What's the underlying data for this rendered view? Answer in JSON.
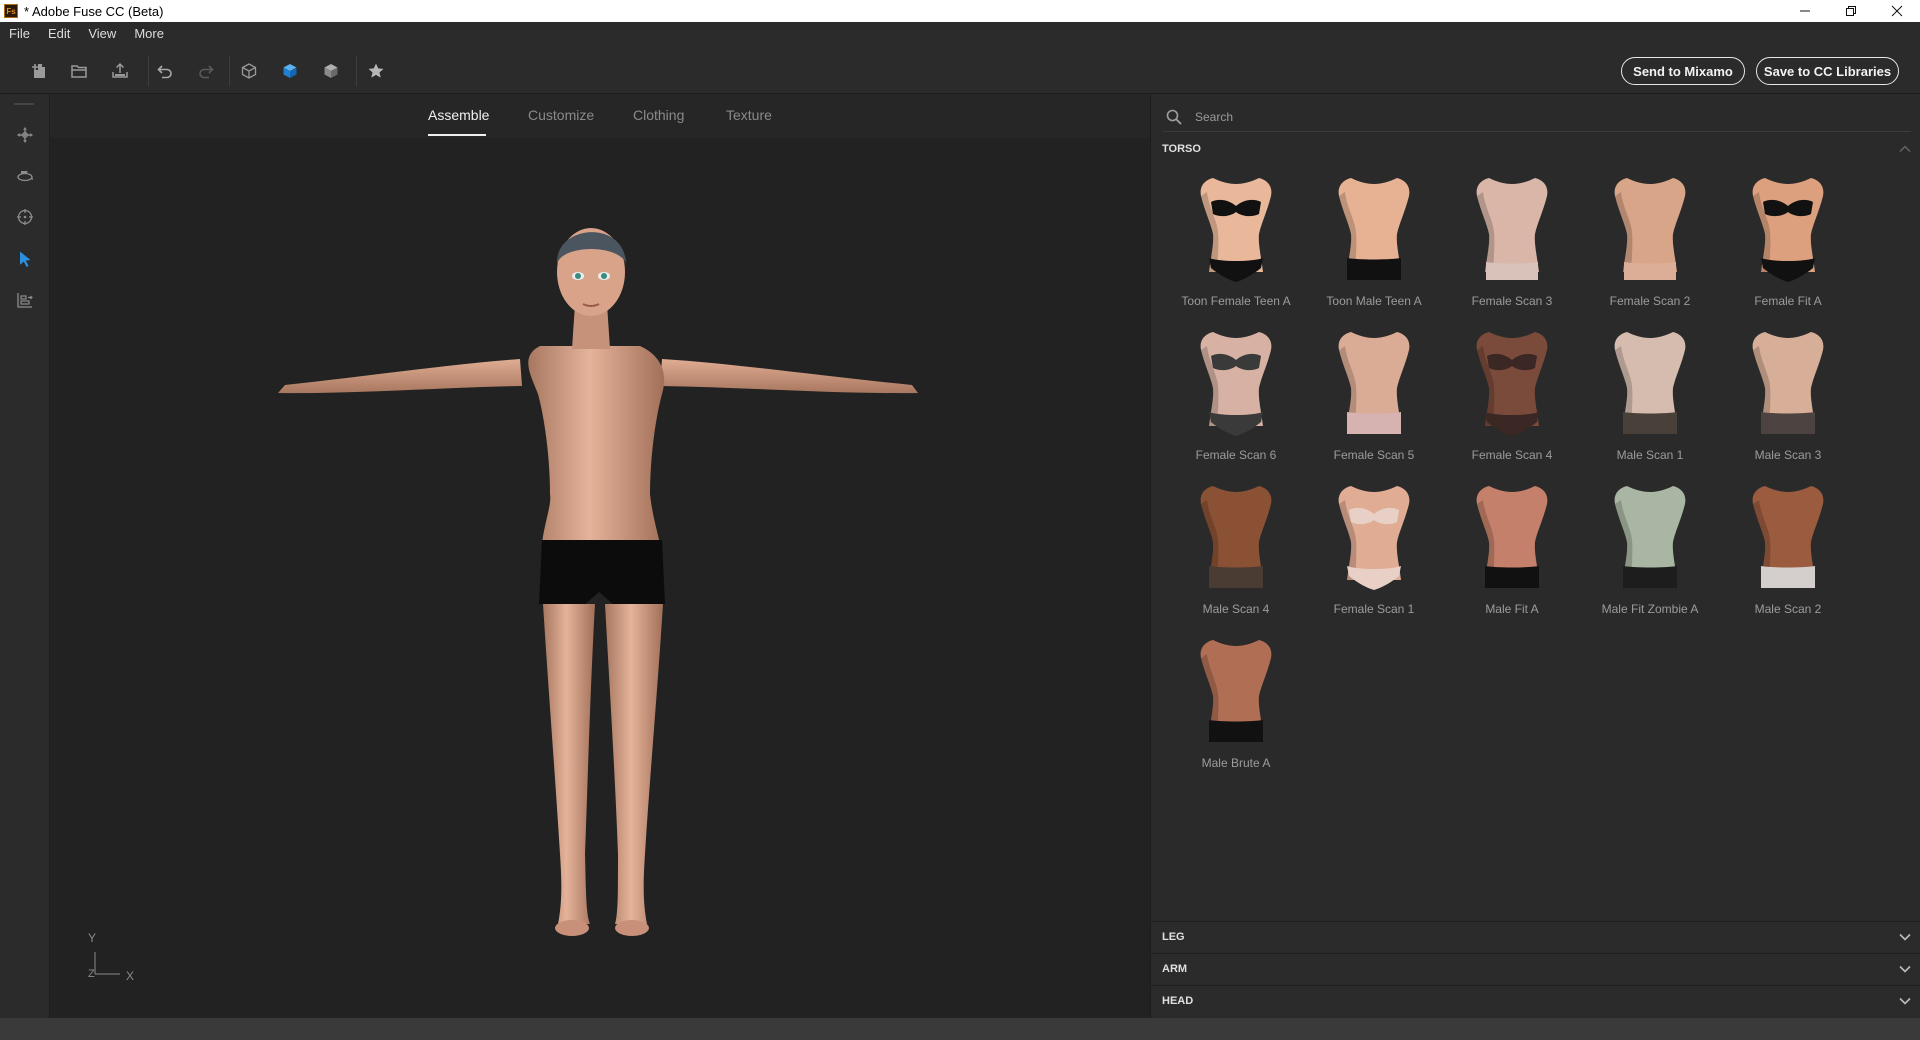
{
  "window": {
    "title": "* Adobe Fuse CC (Beta)",
    "logo_text": "Fs"
  },
  "menu": [
    "File",
    "Edit",
    "View",
    "More"
  ],
  "toolbar": {
    "send_label": "Send to Mixamo",
    "save_label": "Save to CC Libraries",
    "tools": [
      "new-doc-icon",
      "open-folder-icon",
      "export-icon",
      "undo-icon",
      "redo-icon",
      "cube-wire-icon",
      "cube-solid-icon",
      "cube-shaded-icon",
      "star-icon"
    ]
  },
  "left_rail": [
    "move-icon",
    "rotate-view-icon",
    "target-icon",
    "pointer-icon",
    "pose-icon"
  ],
  "viewport": {
    "tabs": [
      "Assemble",
      "Customize",
      "Clothing",
      "Texture"
    ],
    "active_tab": "Assemble",
    "axes": {
      "y": "Y",
      "x": "X",
      "z": "Z"
    }
  },
  "panel": {
    "search_placeholder": "Search",
    "section_open": "TORSO",
    "torso_items": [
      {
        "label": "Toon Female Teen A",
        "tone": "#e9b89a",
        "underwear": "bikini",
        "garment": "#111111"
      },
      {
        "label": "Toon Male Teen A",
        "tone": "#e6b293",
        "underwear": "brief",
        "garment": "#111111"
      },
      {
        "label": "Female Scan 3",
        "tone": "#d9b6a8",
        "underwear": "none",
        "garment": "#d8c2ba"
      },
      {
        "label": "Female Scan 2",
        "tone": "#d9a588",
        "underwear": "none",
        "garment": "#dcae98"
      },
      {
        "label": "Female Fit A",
        "tone": "#dca07f",
        "underwear": "bikini",
        "garment": "#111111"
      },
      {
        "label": "Female Scan 6",
        "tone": "#d7b1a3",
        "underwear": "bikini",
        "garment": "#3a3a3a"
      },
      {
        "label": "Female Scan 5",
        "tone": "#dbac95",
        "underwear": "brief",
        "garment": "#d6b2b0"
      },
      {
        "label": "Female Scan 4",
        "tone": "#7a4b3b",
        "underwear": "bikini",
        "garment": "#3b2824"
      },
      {
        "label": "Male Scan 1",
        "tone": "#d5bcae",
        "underwear": "brief",
        "garment": "#4a403a"
      },
      {
        "label": "Male Scan 3",
        "tone": "#d7ae98",
        "underwear": "brief",
        "garment": "#4d4340"
      },
      {
        "label": "Male Scan 4",
        "tone": "#8b5134",
        "underwear": "brief",
        "garment": "#4a3b33"
      },
      {
        "label": "Female Scan 1",
        "tone": "#e0ad94",
        "underwear": "bikini",
        "garment": "#e8d0c6"
      },
      {
        "label": "Male Fit A",
        "tone": "#c4806a",
        "underwear": "brief",
        "garment": "#111111"
      },
      {
        "label": "Male Fit Zombie A",
        "tone": "#a9b6a3",
        "underwear": "brief",
        "garment": "#1d1d1d"
      },
      {
        "label": "Male Scan 2",
        "tone": "#9a5b3f",
        "underwear": "brief",
        "garment": "#d4cfcd"
      },
      {
        "label": "Male Brute A",
        "tone": "#b06e55",
        "underwear": "brief",
        "garment": "#111111"
      }
    ],
    "collapsed_sections": [
      "LEG",
      "ARM",
      "HEAD"
    ]
  }
}
